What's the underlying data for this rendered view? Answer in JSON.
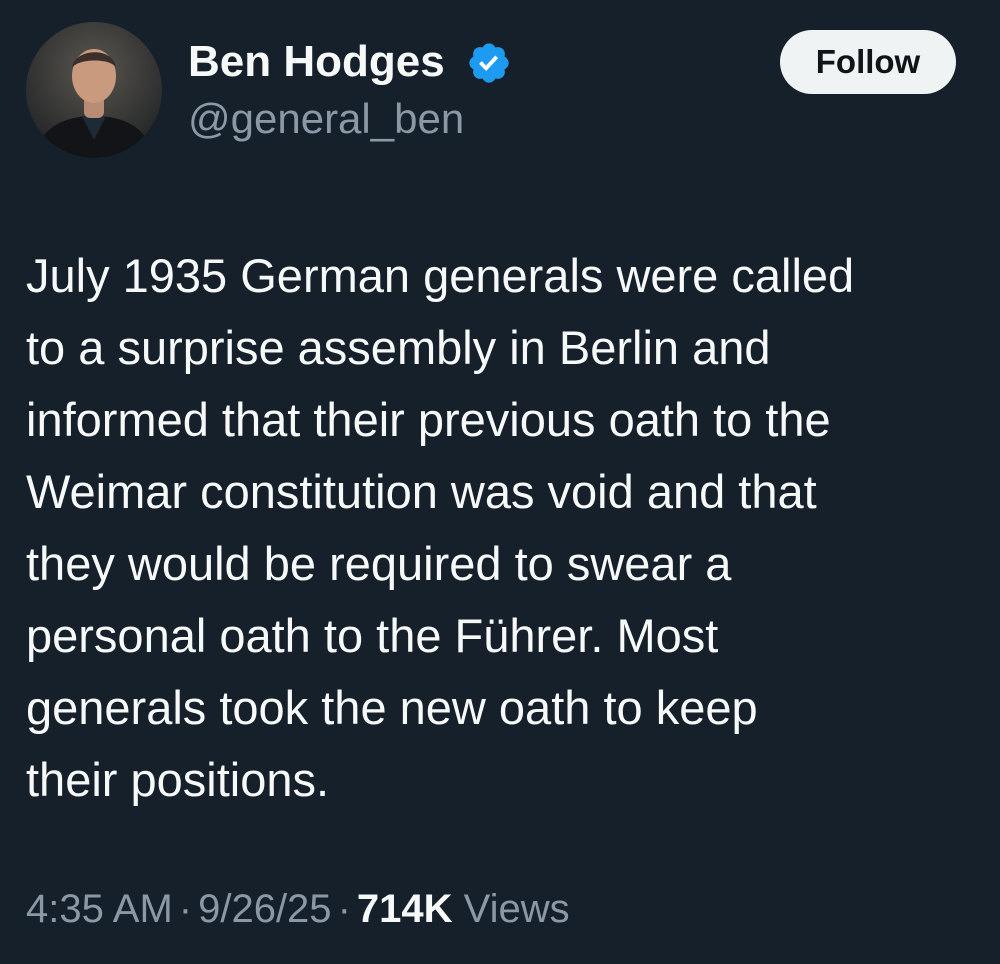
{
  "author": {
    "display_name": "Ben Hodges",
    "handle": "@general_ben",
    "verified_icon": "verified-badge-icon",
    "verified_color": "#1d9bf0"
  },
  "follow_button": {
    "label": "Follow"
  },
  "tweet": {
    "lines": [
      "July 1935 German generals were called",
      "to a surprise assembly in Berlin and",
      "informed that their previous oath to the",
      "Weimar constitution was void and that",
      "they would be required to swear a",
      "personal oath to the Führer. Most",
      "generals took the new oath to keep",
      "their positions."
    ]
  },
  "meta": {
    "time": "4:35 AM",
    "separator": "·",
    "date": "9/26/25",
    "views_count": "714K",
    "views_label": "Views"
  },
  "colors": {
    "background": "#15202b",
    "text_primary": "#f7f9f9",
    "text_secondary": "#8b98a5",
    "button_bg": "#eff3f4"
  }
}
